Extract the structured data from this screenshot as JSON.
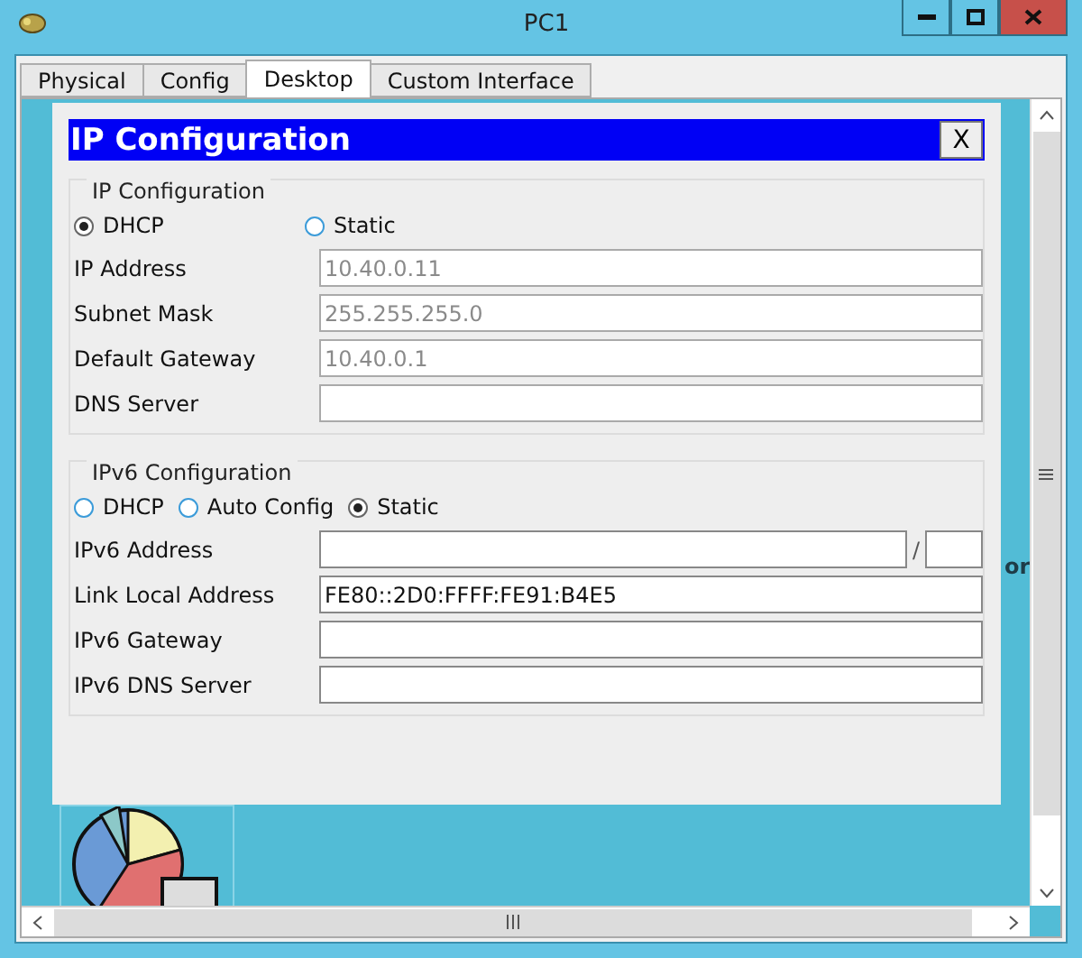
{
  "window": {
    "title": "PC1"
  },
  "tabs": [
    {
      "label": "Physical",
      "selected": false
    },
    {
      "label": "Config",
      "selected": false
    },
    {
      "label": "Desktop",
      "selected": true
    },
    {
      "label": "Custom Interface",
      "selected": false
    }
  ],
  "desktop": {
    "background_text": "or"
  },
  "dialog": {
    "title": "IP Configuration",
    "close": "X",
    "ipv4": {
      "legend": "IP Configuration",
      "modes": [
        {
          "label": "DHCP",
          "selected": true
        },
        {
          "label": "Static",
          "selected": false
        }
      ],
      "fields": [
        {
          "label": "IP Address",
          "value": "10.40.0.11",
          "disabled": true
        },
        {
          "label": "Subnet Mask",
          "value": "255.255.255.0",
          "disabled": true
        },
        {
          "label": "Default Gateway",
          "value": "10.40.0.1",
          "disabled": true
        },
        {
          "label": "DNS Server",
          "disabled": true
        }
      ]
    },
    "ipv6": {
      "legend": "IPv6 Configuration",
      "modes": [
        {
          "label": "DHCP",
          "selected": false
        },
        {
          "label": "Auto Config",
          "selected": false
        },
        {
          "label": "Static",
          "selected": true
        }
      ],
      "fields": [
        {
          "label": "IPv6 Address",
          "kind": "prefixed",
          "separator": "/",
          "disabled": false
        },
        {
          "label": "Link Local Address",
          "kind": "plain",
          "value": "FE80::2D0:FFFF:FE91:B4E5",
          "disabled": false
        },
        {
          "label": "IPv6 Gateway",
          "kind": "plain",
          "disabled": false
        },
        {
          "label": "IPv6 DNS Server",
          "kind": "plain",
          "disabled": false
        }
      ]
    }
  }
}
